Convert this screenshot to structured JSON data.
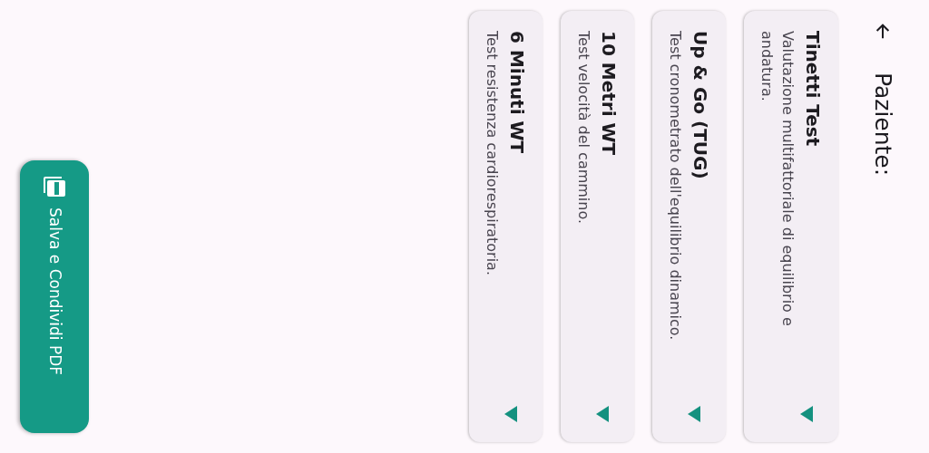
{
  "header": {
    "title": "Paziente:"
  },
  "tests": [
    {
      "title": "Tinetti Test",
      "description": "Valutazione multifattoriale di equilibrio e andatura.",
      "expanded": false
    },
    {
      "title": "Up & Go (TUG)",
      "description": "Test cronometrato dell'equilibrio dinamico.",
      "expanded": false
    },
    {
      "title": "10 Metri WT",
      "description": "Test velocità del cammino.",
      "expanded": false
    },
    {
      "title": "6 Minuti WT",
      "description": "Test resistenza cardiorespiratoria.",
      "expanded": false
    }
  ],
  "action_button": {
    "label": "Salva e Condividi PDF"
  }
}
